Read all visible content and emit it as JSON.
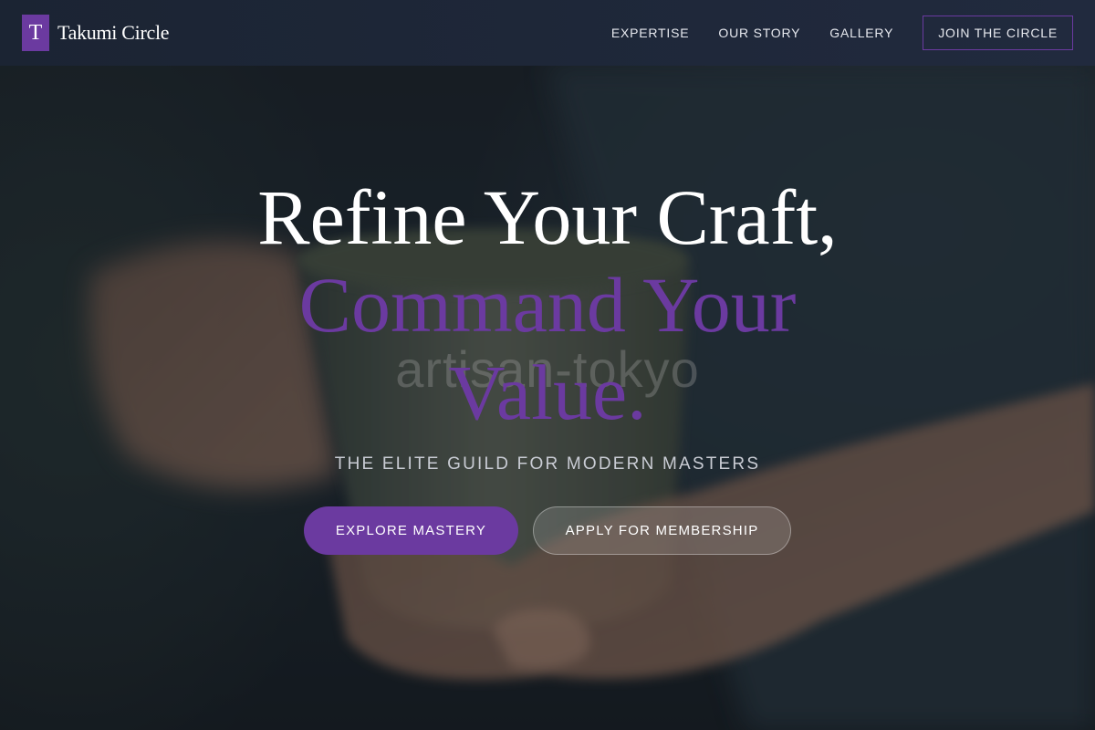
{
  "brand": {
    "logo_mark": "T",
    "name": "Takumi Circle",
    "accent_color": "#6b3aa0"
  },
  "nav": {
    "items": [
      {
        "label": "EXPERTISE"
      },
      {
        "label": "OUR STORY"
      },
      {
        "label": "GALLERY"
      }
    ],
    "cta_label": "JOIN THE CIRCLE"
  },
  "hero": {
    "background_image": "hands-holding-ceramic-mug",
    "watermark_text": "artisan-tokyo",
    "headline_line1": "Refine Your Craft,",
    "headline_line2": "Command Your Value.",
    "tagline": "THE ELITE GUILD FOR MODERN MASTERS",
    "primary_button": "EXPLORE MASTERY",
    "secondary_button": "APPLY FOR MEMBERSHIP"
  }
}
